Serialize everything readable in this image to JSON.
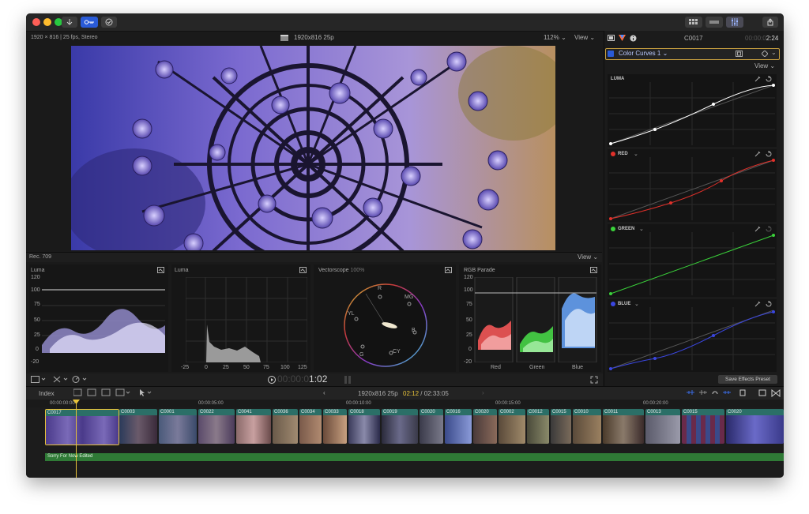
{
  "toolbar": {
    "import_icon": "download-arrow-icon",
    "keyword_icon": "key-icon",
    "check_icon": "checkmark-circle-icon",
    "share_icon": "share-icon"
  },
  "viewer_header": {
    "format_left": "1920 × 816 | 25 fps, Stereo",
    "format_center": "1920x816 25p",
    "zoom": "112%",
    "view_label": "View"
  },
  "inspector": {
    "clip_name": "C0017",
    "timecode_dim": "00:00:0",
    "timecode_bright": "2:24",
    "effect_name": "Color Curves 1",
    "view_label": "View",
    "save_button": "Save Effects Preset",
    "curves": [
      {
        "label": "LUMA",
        "color": "#ffffff"
      },
      {
        "label": "RED",
        "color": "#e0302a"
      },
      {
        "label": "GREEN",
        "color": "#3ad13a"
      },
      {
        "label": "BLUE",
        "color": "#3a46e0"
      }
    ]
  },
  "scopes_header": {
    "colorspace": "Rec. 709",
    "view_label": "View"
  },
  "scopes": {
    "waveform_title": "Luma",
    "histogram_title": "Luma",
    "vectorscope_title": "Vectorscope",
    "vectorscope_pct": "100%",
    "parade_title": "RGB Parade",
    "waveform_ticks": [
      "120",
      "100",
      "75",
      "50",
      "25",
      "0",
      "-20"
    ],
    "histogram_ticks": [
      "-25",
      "0",
      "25",
      "50",
      "75",
      "100",
      "125"
    ],
    "parade_ticks": [
      "120",
      "100",
      "75",
      "50",
      "25",
      "0",
      "-20"
    ],
    "parade_labels": [
      "Red",
      "Green",
      "Blue"
    ],
    "vector_targets": [
      "R",
      "MG",
      "B",
      "CY",
      "G",
      "YL"
    ]
  },
  "playback": {
    "timecode_dim": "00:00:0",
    "timecode_bright": "1:02"
  },
  "timeline_header": {
    "index_label": "Index",
    "format": "1920x816 25p",
    "position": "02:12",
    "duration": "02:33:05"
  },
  "ruler": [
    "00:00:00:00",
    "00:00:05:00",
    "00:00:10:00",
    "00:00:15:00",
    "00:00:20:00"
  ],
  "clips": [
    "C0017",
    "C0003",
    "C0001",
    "C0022",
    "C0041",
    "C0036",
    "C0034",
    "C0033",
    "C0018",
    "C0019",
    "C0020",
    "C0016",
    "C0020",
    "C0002",
    "C0012",
    "C0015",
    "C0010",
    "C0011",
    "C0013",
    "C0015",
    "C0020"
  ],
  "audio_track": "Sorry For Now Edited",
  "colors": {
    "accent_blue": "#2a5bd7",
    "playhead": "#e8c33a",
    "clip_teal": "#2b6f67",
    "audio_green": "#2f7a36"
  }
}
